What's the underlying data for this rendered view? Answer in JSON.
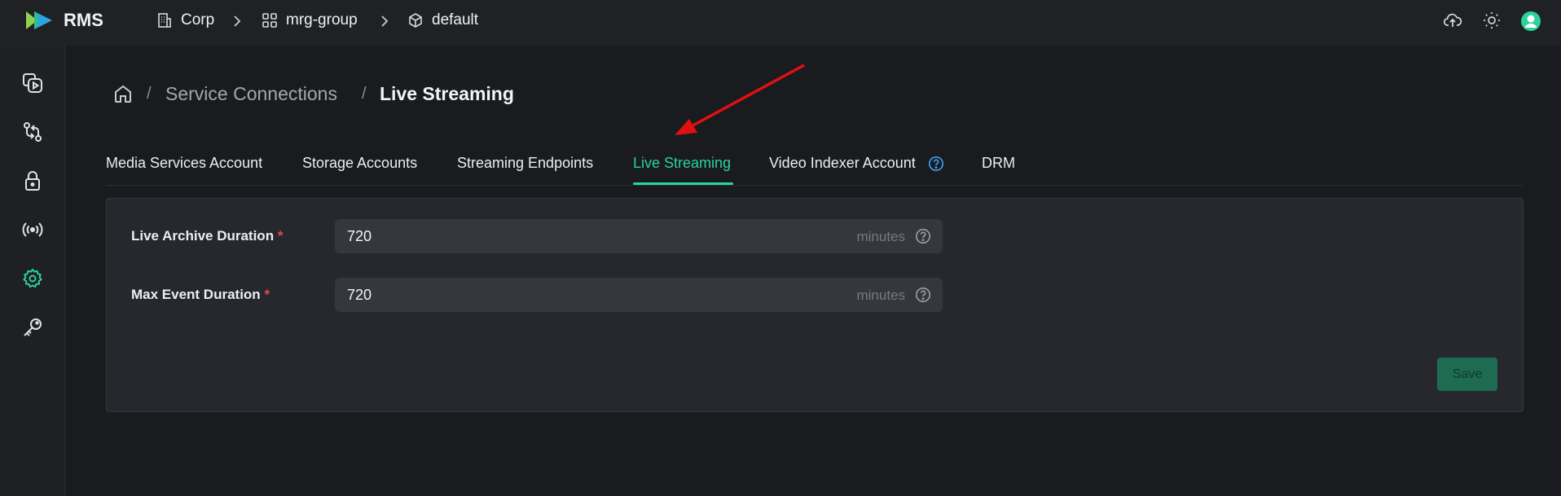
{
  "app": {
    "name": "RMS"
  },
  "header": {
    "breadcrumbs": [
      {
        "label": "Corp",
        "icon": "building-icon"
      },
      {
        "label": "mrg-group",
        "icon": "grid-icon"
      },
      {
        "label": "default",
        "icon": "cube-icon"
      }
    ],
    "right_icons": [
      "upload-icon",
      "sun-icon",
      "user-avatar-icon"
    ]
  },
  "sidebar": {
    "items": [
      {
        "icon": "media-icon"
      },
      {
        "icon": "transfer-icon"
      },
      {
        "icon": "lock-icon"
      },
      {
        "icon": "broadcast-icon"
      },
      {
        "icon": "settings-icon",
        "active": true
      },
      {
        "icon": "key-icon"
      }
    ]
  },
  "breadcrumb": {
    "link": "Service Connections",
    "separator": "/",
    "current": "Live Streaming"
  },
  "tabs": [
    {
      "label": "Media Services Account"
    },
    {
      "label": "Storage Accounts"
    },
    {
      "label": "Streaming Endpoints"
    },
    {
      "label": "Live Streaming",
      "active": true
    },
    {
      "label": "Video Indexer Account"
    },
    {
      "label": "DRM"
    }
  ],
  "form": {
    "fields": [
      {
        "label": "Live Archive Duration",
        "required_mark": "*",
        "value": "720",
        "unit": "minutes"
      },
      {
        "label": "Max Event Duration",
        "required_mark": "*",
        "value": "720",
        "unit": "minutes"
      }
    ],
    "save_label": "Save"
  },
  "colors": {
    "accent": "#2ad39a",
    "background": "#1a1b1f",
    "panel": "#27282d",
    "required": "#e5484d",
    "annotation_arrow": "#e01010"
  }
}
